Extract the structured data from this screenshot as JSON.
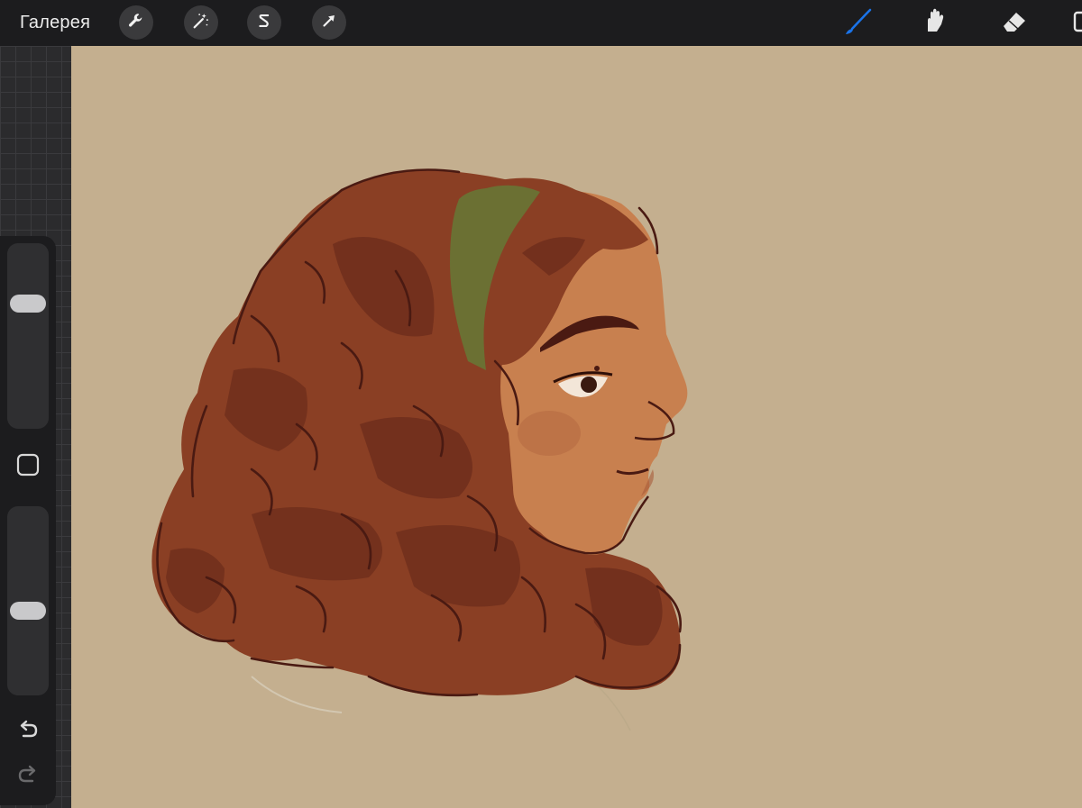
{
  "topbar": {
    "gallery_label": "Галерея",
    "left_tools": [
      {
        "name": "actions",
        "icon": "wrench-icon"
      },
      {
        "name": "adjustments",
        "icon": "magic-wand-icon"
      },
      {
        "name": "selection",
        "icon": "selection-s-icon"
      },
      {
        "name": "transform",
        "icon": "arrow-cursor-icon"
      }
    ],
    "right_tools": [
      {
        "name": "brush",
        "icon": "brush-icon",
        "active": true
      },
      {
        "name": "smudge",
        "icon": "smudge-icon",
        "active": false
      },
      {
        "name": "eraser",
        "icon": "eraser-icon",
        "active": false
      }
    ],
    "active_color": "#1a73e8"
  },
  "sidebar": {
    "brush_size_level": 0.7,
    "brush_opacity_level": 0.44,
    "modify_icon": "square-icon",
    "undo_icon": "undo-icon",
    "redo_icon": "redo-icon"
  },
  "canvas": {
    "background_color": "#c4af8f",
    "artwork": "portrait-illustration"
  },
  "colors": {
    "hair": "#8a3f24",
    "hair_shadow": "#6e2e1c",
    "skin": "#c8804f",
    "skin_shadow": "#b86e44",
    "headband": "#6b7033",
    "outline": "#4a1a12"
  }
}
